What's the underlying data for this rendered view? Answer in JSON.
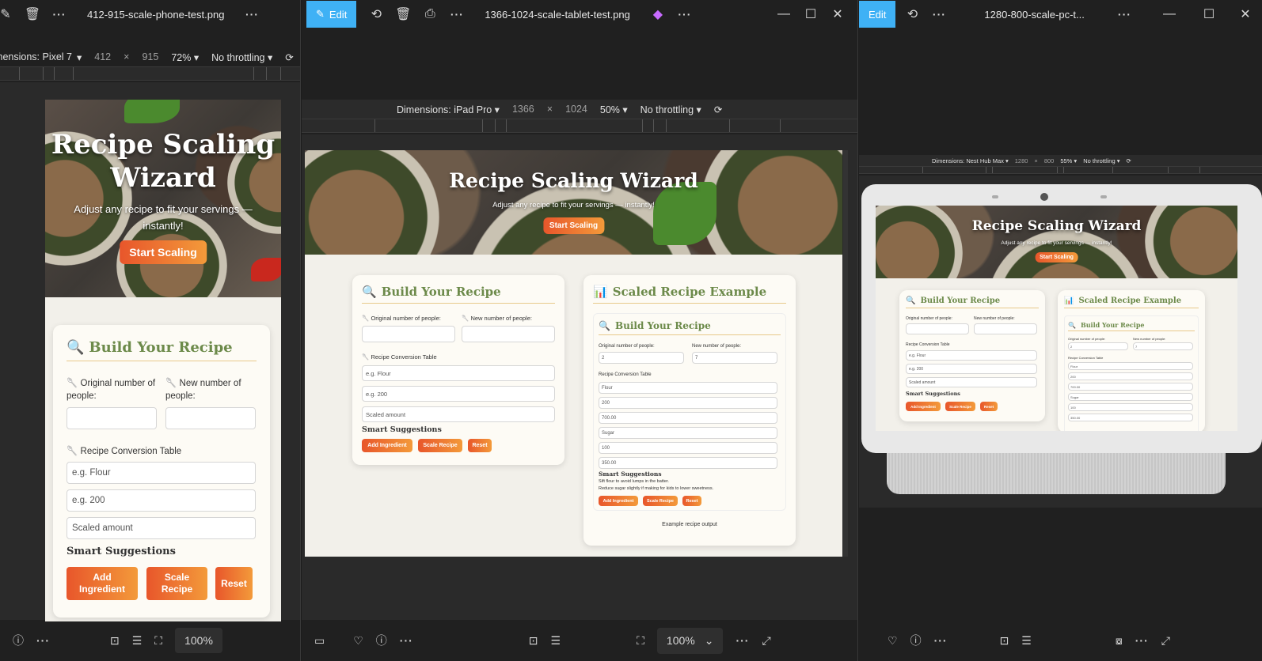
{
  "windows": [
    {
      "filename": "412-915-scale-phone-test.png",
      "device": {
        "dimensions_label": "Dimensions: Pixel 7",
        "width": "412",
        "times": "×",
        "height": "915",
        "zoom": "72%",
        "throttle": "No throttling"
      },
      "zoom": "100%"
    },
    {
      "edit_label": "Edit",
      "filename": "1366-1024-scale-tablet-test.png",
      "device": {
        "dimensions_label": "Dimensions: iPad Pro",
        "width": "1366",
        "times": "×",
        "height": "1024",
        "zoom": "50%",
        "throttle": "No throttling"
      },
      "zoom": "100%"
    },
    {
      "edit_label": "Edit",
      "filename": "1280-800-scale-pc-t...",
      "device": {
        "dimensions_label": "Dimensions: Nest Hub Max",
        "width": "1280",
        "times": "×",
        "height": "800",
        "zoom": "55%",
        "throttle": "No throttling"
      }
    }
  ],
  "app": {
    "hero_title": "Recipe Scaling Wizard",
    "hero_title_line1": "Recipe Scaling",
    "hero_title_line2": "Wizard",
    "hero_subtitle": "Adjust any recipe to fit your servings — instantly!",
    "hero_sub_line1": "Adjust any recipe to fit your servings —",
    "hero_sub_line2": "instantly!",
    "start_button": "Start Scaling",
    "build_title": "Build Your Recipe",
    "original_label": "Original number of people:",
    "new_label": "New number of people:",
    "original_line1": "Original number of",
    "original_line2": "people:",
    "new_line1": "New number of",
    "new_line2": "people:",
    "table_label": "Recipe Conversion Table",
    "ingredient_placeholder": "e.g. Flour",
    "amount_placeholder": "e.g. 200",
    "scaled_placeholder": "Scaled amount",
    "smart_suggestions": "Smart Suggestions",
    "add_ingredient": "Add Ingredient",
    "add_line1": "Add",
    "add_line2": "Ingredient",
    "scale_recipe": "Scale Recipe",
    "scale_line1": "Scale",
    "scale_line2": "Recipe",
    "reset": "Reset",
    "example_title": "Scaled Recipe Example",
    "example": {
      "orig_value": "2",
      "new_value": "7",
      "rows": [
        "Flour",
        "200",
        "700.00",
        "Sugar",
        "100",
        "350.00"
      ],
      "suggestion1": "Sift flour to avoid lumps in the batter.",
      "suggestion2": "Reduce sugar slightly if making for kids to lower sweetness.",
      "caption": "Example recipe output"
    }
  }
}
